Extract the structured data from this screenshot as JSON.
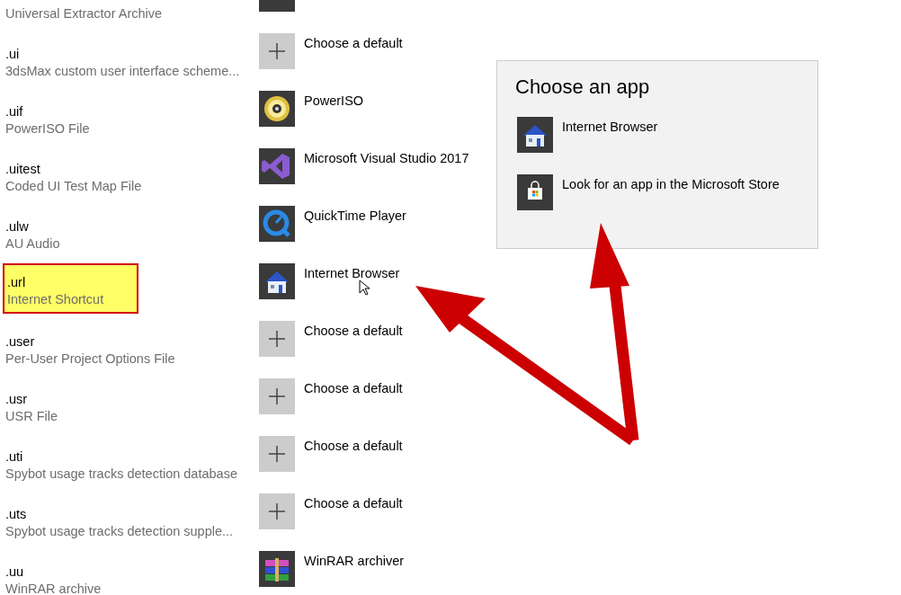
{
  "associations": [
    {
      "description": "Universal Extractor Archive",
      "app": {
        "kind": "extractor"
      }
    },
    {
      "extension": ".ui",
      "description": "3dsMax custom user interface scheme...",
      "app": {
        "kind": "choose",
        "name": "Choose a default"
      }
    },
    {
      "extension": ".uif",
      "description": "PowerISO File",
      "app": {
        "kind": "disc",
        "name": "PowerISO"
      }
    },
    {
      "extension": ".uitest",
      "description": "Coded UI Test Map File",
      "app": {
        "kind": "studio",
        "name": "Microsoft Visual Studio 2017"
      }
    },
    {
      "extension": ".ulw",
      "description": "AU Audio",
      "app": {
        "kind": "quicktime",
        "name": "QuickTime Player"
      }
    },
    {
      "extension": ".url",
      "description": "Internet Shortcut",
      "highlighted": true,
      "app": {
        "kind": "house",
        "name": "Internet Browser"
      }
    },
    {
      "extension": ".user",
      "description": "Per-User Project Options File",
      "app": {
        "kind": "choose",
        "name": "Choose a default"
      }
    },
    {
      "extension": ".usr",
      "description": "USR File",
      "app": {
        "kind": "choose",
        "name": "Choose a default"
      }
    },
    {
      "extension": ".uti",
      "description": "Spybot usage tracks detection database",
      "app": {
        "kind": "choose",
        "name": "Choose a default"
      }
    },
    {
      "extension": ".uts",
      "description": "Spybot usage tracks detection supple...",
      "app": {
        "kind": "choose",
        "name": "Choose a default"
      }
    },
    {
      "extension": ".uu",
      "description": "WinRAR archive",
      "app": {
        "kind": "archive",
        "name": "WinRAR archiver"
      }
    }
  ],
  "choose_app_popup": {
    "title": "Choose an app",
    "options": [
      {
        "kind": "house",
        "name": "Internet Browser"
      },
      {
        "kind": "store",
        "name": "Look for an app in the Microsoft Store"
      }
    ]
  }
}
